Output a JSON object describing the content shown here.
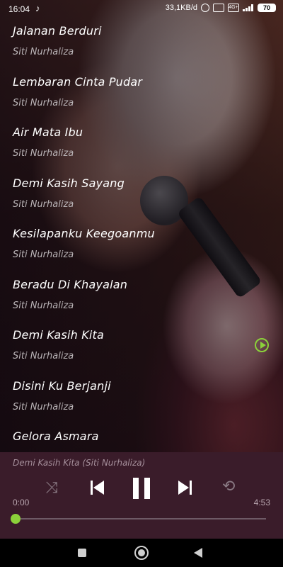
{
  "status_bar": {
    "time": "16:04",
    "network_speed": "33,1KB/d",
    "battery": "70",
    "network_type": "4G+"
  },
  "songs": [
    {
      "title": "Jalanan Berduri",
      "artist": "Siti Nurhaliza"
    },
    {
      "title": "Lembaran Cinta Pudar",
      "artist": "Siti Nurhaliza"
    },
    {
      "title": "Air Mata Ibu",
      "artist": "Siti Nurhaliza"
    },
    {
      "title": "Demi Kasih Sayang",
      "artist": "Siti Nurhaliza"
    },
    {
      "title": "Kesilapanku Keegoanmu",
      "artist": "Siti Nurhaliza"
    },
    {
      "title": "Beradu Di Khayalan",
      "artist": "Siti Nurhaliza"
    },
    {
      "title": "Demi Kasih Kita",
      "artist": "Siti Nurhaliza"
    },
    {
      "title": "Disini Ku Berjanji",
      "artist": "Siti Nurhaliza"
    },
    {
      "title": "Gelora Asmara",
      "artist": ""
    }
  ],
  "player": {
    "now_playing": "Demi Kasih Kita (Siti Nurhaliza)",
    "current_time": "0:00",
    "total_time": "4:53",
    "progress_fraction": 0.0
  },
  "colors": {
    "accent": "#8bd13a",
    "player_bg": "#3a1c2a"
  },
  "icons": {
    "shuffle": "shuffle-icon",
    "previous": "previous-icon",
    "pause": "pause-icon",
    "next": "next-icon",
    "repeat": "repeat-icon"
  }
}
